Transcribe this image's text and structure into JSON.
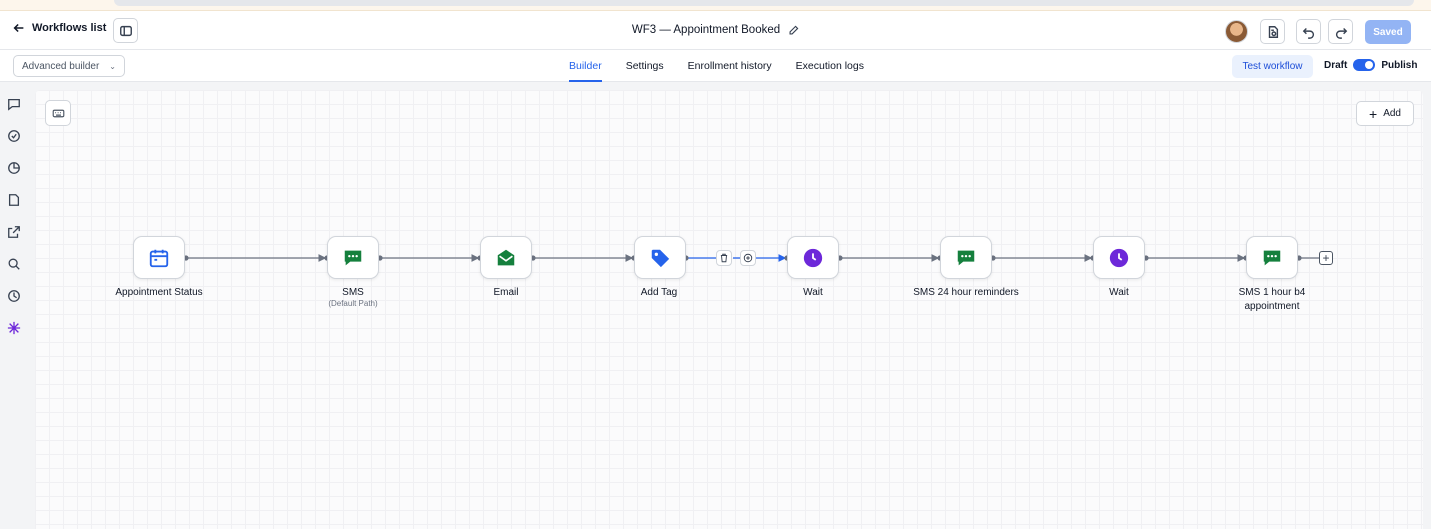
{
  "header": {
    "back_label": "Workflows list",
    "title": "WF3 — Appointment Booked",
    "saved_label": "Saved"
  },
  "subbar": {
    "builder_mode": "Advanced builder",
    "tabs": [
      {
        "label": "Builder",
        "active": true
      },
      {
        "label": "Settings",
        "active": false
      },
      {
        "label": "Enrollment history",
        "active": false
      },
      {
        "label": "Execution logs",
        "active": false
      }
    ],
    "test_label": "Test workflow",
    "draft_label": "Draft",
    "publish_label": "Publish",
    "publish_on": true
  },
  "rail": {
    "icons": [
      "chat-icon",
      "check-circle-icon",
      "pie-chart-icon",
      "document-icon",
      "external-link-icon",
      "search-icon",
      "history-icon",
      "sparkle-icon"
    ]
  },
  "canvas": {
    "add_label": "Add",
    "nodes": [
      {
        "label": "Appointment Status",
        "sublabel": "",
        "icon": "calendar-icon",
        "color": "#2563eb"
      },
      {
        "label": "SMS",
        "sublabel": "(Default Path)",
        "icon": "sms-icon",
        "color": "#15803d"
      },
      {
        "label": "Email",
        "sublabel": "",
        "icon": "email-icon",
        "color": "#15803d"
      },
      {
        "label": "Add Tag",
        "sublabel": "",
        "icon": "tag-icon",
        "color": "#2563eb"
      },
      {
        "label": "Wait",
        "sublabel": "",
        "icon": "clock-icon",
        "color": "#6d28d9"
      },
      {
        "label": "SMS 24 hour reminders",
        "sublabel": "",
        "icon": "sms-icon",
        "color": "#15803d"
      },
      {
        "label": "Wait",
        "sublabel": "",
        "icon": "clock-icon",
        "color": "#6d28d9"
      },
      {
        "label": "SMS 1 hour b4 appointment",
        "sublabel": "",
        "icon": "sms-icon",
        "color": "#15803d"
      }
    ]
  }
}
